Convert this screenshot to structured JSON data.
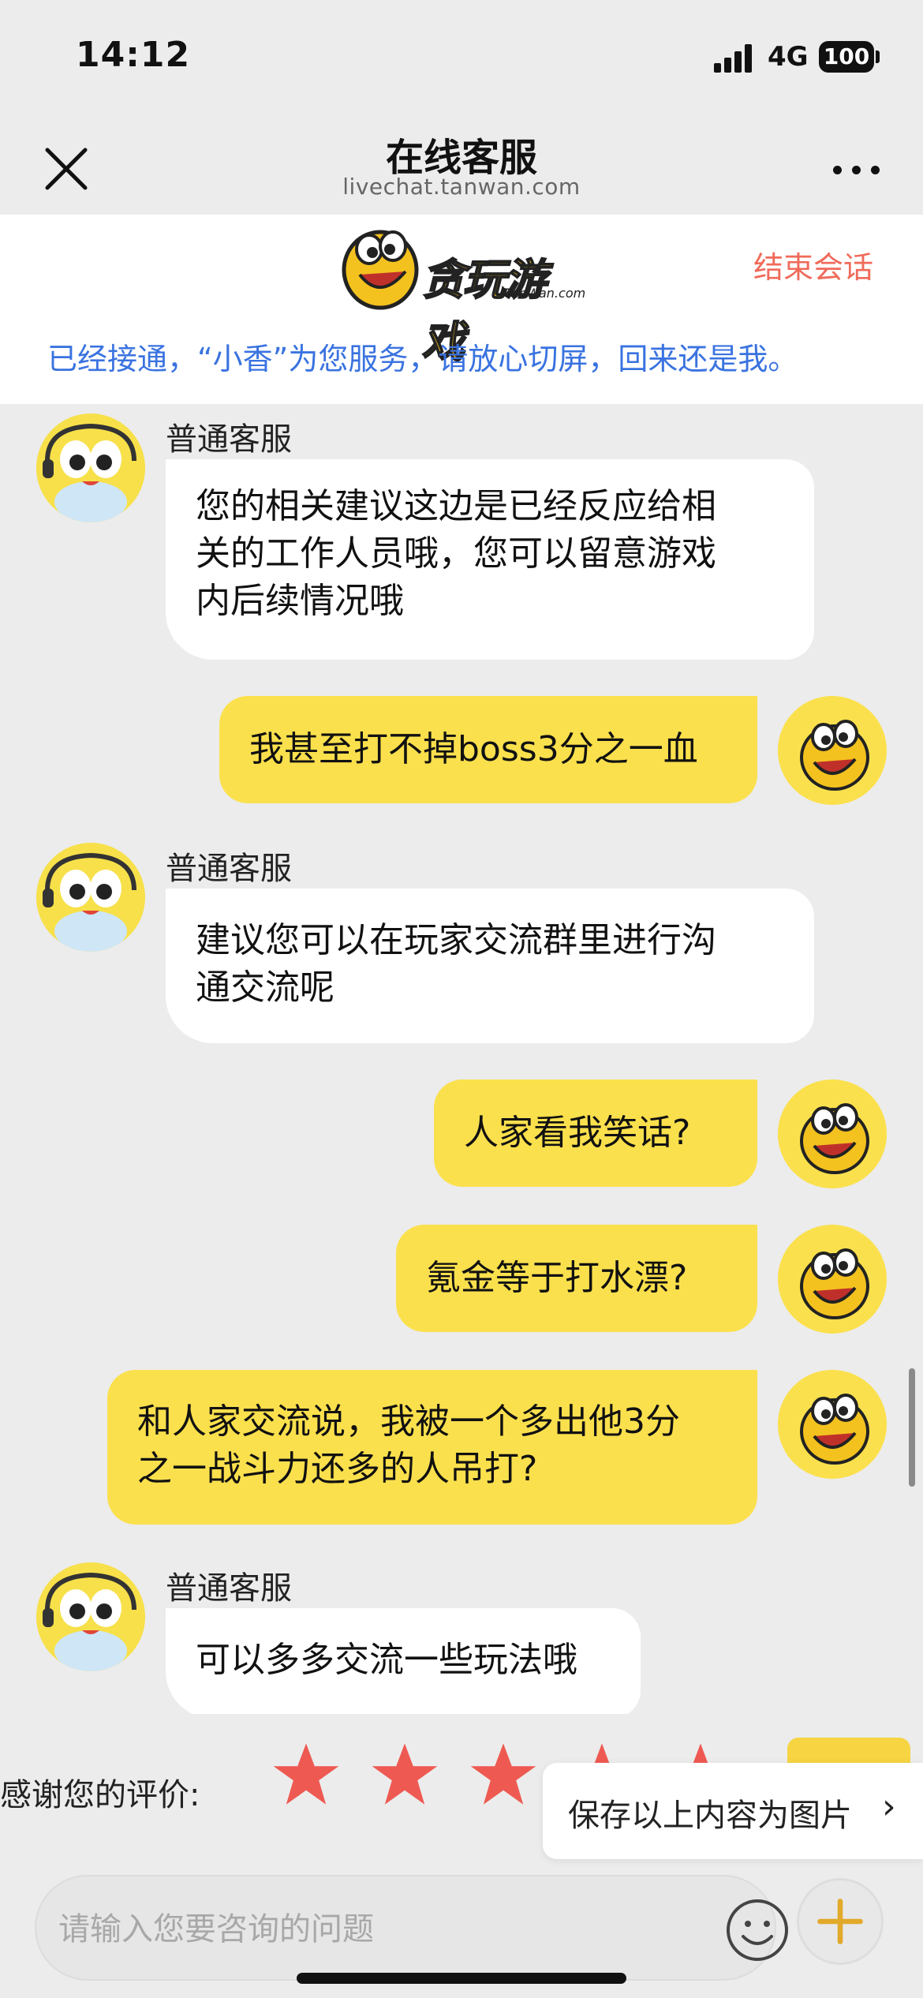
{
  "status": {
    "time": "14:12",
    "network": "4G",
    "battery": "100"
  },
  "nav": {
    "title": "在线客服",
    "url": "livechat.tanwan.com"
  },
  "header": {
    "logo_text": "贪玩游戏",
    "logo_sub": "TanWan.com",
    "end_session": "结束会话",
    "notice": "已经接通，“小香”为您服务，请放心切屏，回来还是我。"
  },
  "messages": [
    {
      "side": "in",
      "sender": "普通客服",
      "lines": [
        "您的相关建议这边是已经反应给相",
        "关的工作人员哦，您可以留意游戏",
        "内后续情况哦"
      ]
    },
    {
      "side": "out",
      "lines": [
        "我甚至打不掉boss3分之一血"
      ]
    },
    {
      "side": "in",
      "sender": "普通客服",
      "lines": [
        "建议您可以在玩家交流群里进行沟",
        "通交流呢"
      ]
    },
    {
      "side": "out",
      "lines": [
        "人家看我笑话?"
      ]
    },
    {
      "side": "out",
      "lines": [
        "氪金等于打水漂?"
      ]
    },
    {
      "side": "out",
      "lines": [
        "和人家交流说，我被一个多出他3分",
        "之一战斗力还多的人吊打?"
      ]
    },
    {
      "side": "in",
      "sender": "普通客服",
      "lines": [
        "可以多多交流一些玩法哦"
      ]
    }
  ],
  "rating": {
    "label": "感谢您的评价:",
    "stars": 5,
    "save_popup": "保存以上内容为图片",
    "save_chevron": "›"
  },
  "input": {
    "placeholder": "请输入您要咨询的问题"
  },
  "colors": {
    "accent_yellow": "#fbe04d",
    "end_red": "#f06a5a",
    "notice_blue": "#3a73e0",
    "star_red": "#ee5a52"
  },
  "icons": [
    "close-icon",
    "more-icon",
    "agent-avatar-icon",
    "user-avatar-icon",
    "star-icon",
    "emoji-icon",
    "plus-icon",
    "chevron-right-icon"
  ]
}
